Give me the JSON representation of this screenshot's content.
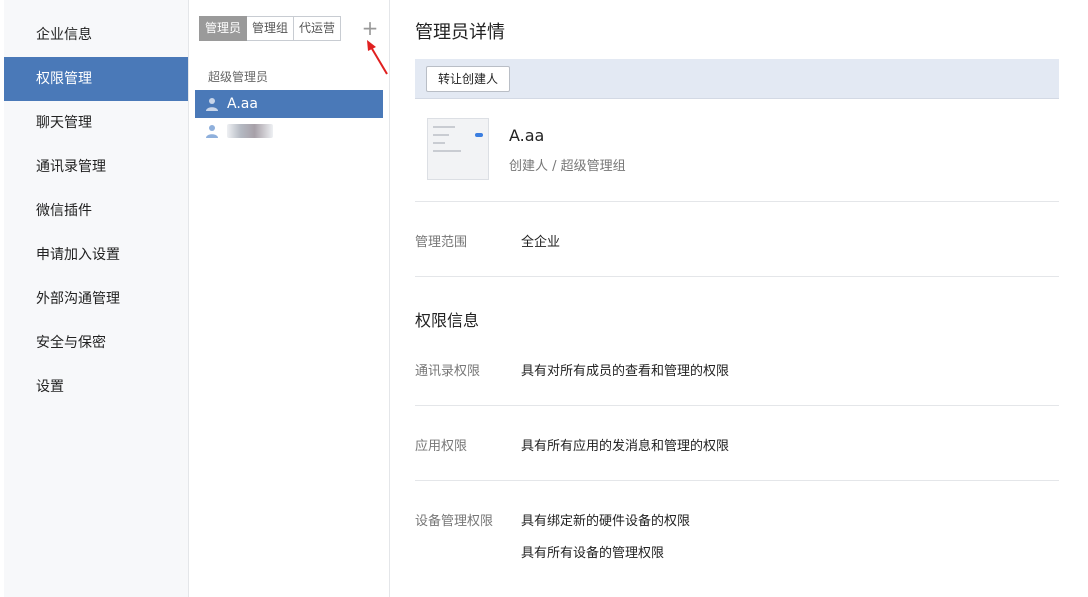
{
  "sidebar": {
    "items": [
      {
        "label": "企业信息"
      },
      {
        "label": "权限管理"
      },
      {
        "label": "聊天管理"
      },
      {
        "label": "通讯录管理"
      },
      {
        "label": "微信插件"
      },
      {
        "label": "申请加入设置"
      },
      {
        "label": "外部沟通管理"
      },
      {
        "label": "安全与保密"
      },
      {
        "label": "设置"
      }
    ],
    "active_index": 1
  },
  "admin_list": {
    "tabs": [
      {
        "label": "管理员"
      },
      {
        "label": "管理组"
      },
      {
        "label": "代运营"
      }
    ],
    "add_icon": "plus-icon",
    "section_label": "超级管理员",
    "members": [
      {
        "name": "A.aa",
        "icon": "person-icon"
      },
      {
        "name": "",
        "icon": "person-icon"
      }
    ]
  },
  "detail": {
    "title": "管理员详情",
    "transfer_button": "转让创建人",
    "name": "A.aa",
    "role": "创建人 / 超级管理组",
    "scope_label": "管理范围",
    "scope_value": "全企业",
    "perm_title": "权限信息",
    "permissions": [
      {
        "label": "通讯录权限",
        "values": [
          "具有对所有成员的查看和管理的权限"
        ]
      },
      {
        "label": "应用权限",
        "values": [
          "具有所有应用的发消息和管理的权限"
        ]
      },
      {
        "label": "设备管理权限",
        "values": [
          "具有绑定新的硬件设备的权限",
          "具有所有设备的管理权限"
        ]
      }
    ]
  },
  "colors": {
    "accent": "#4a79b8",
    "annotation_arrow": "#e02020"
  }
}
